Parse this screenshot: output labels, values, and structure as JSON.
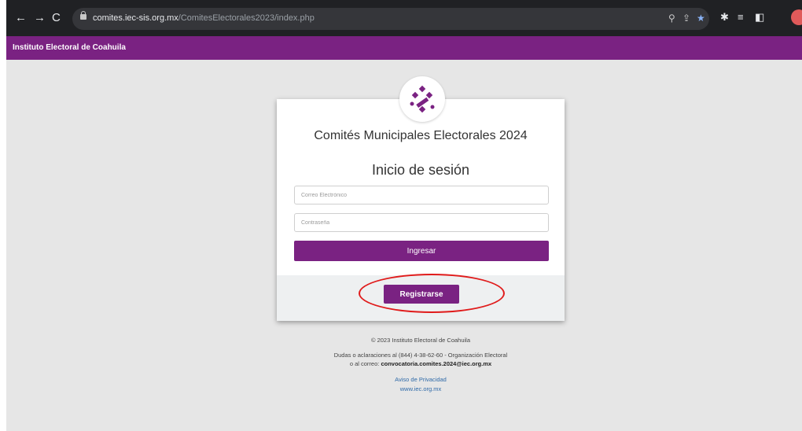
{
  "browser": {
    "url_host": "comites.iec-sis.org.mx",
    "url_path": "/ComitesElectorales2023/index.php"
  },
  "site": {
    "header_title": "Instituto Electoral de Coahuila"
  },
  "login": {
    "title": "Comités Municipales Electorales 2024",
    "subtitle": "Inicio de sesión",
    "email_placeholder": "Correo Electrónico",
    "password_placeholder": "Contraseña",
    "login_label": "Ingresar",
    "register_label": "Registrarse"
  },
  "footer": {
    "copyright": "© 2023 Instituto Electoral de Coahuila",
    "contact_line1": "Dudas o aclaraciones al (844) 4-38-62-60 - Organización Electoral",
    "contact_prefix": "o al correo:",
    "contact_email": "convocatoria.comites.2024@iec.org.mx",
    "privacy_link": "Aviso de Privacidad",
    "site_link": "www.iec.org.mx"
  },
  "colors": {
    "brand_purple": "#7a2282",
    "annotation_red": "#e01b1b"
  },
  "icons": [
    "back-arrow-icon",
    "forward-arrow-icon",
    "reload-icon",
    "lock-icon",
    "zoom-icon",
    "share-icon",
    "bookmark-star-icon",
    "extensions-icon",
    "reading-list-icon",
    "side-panel-icon",
    "profile-avatar-icon",
    "iec-logo-icon"
  ]
}
